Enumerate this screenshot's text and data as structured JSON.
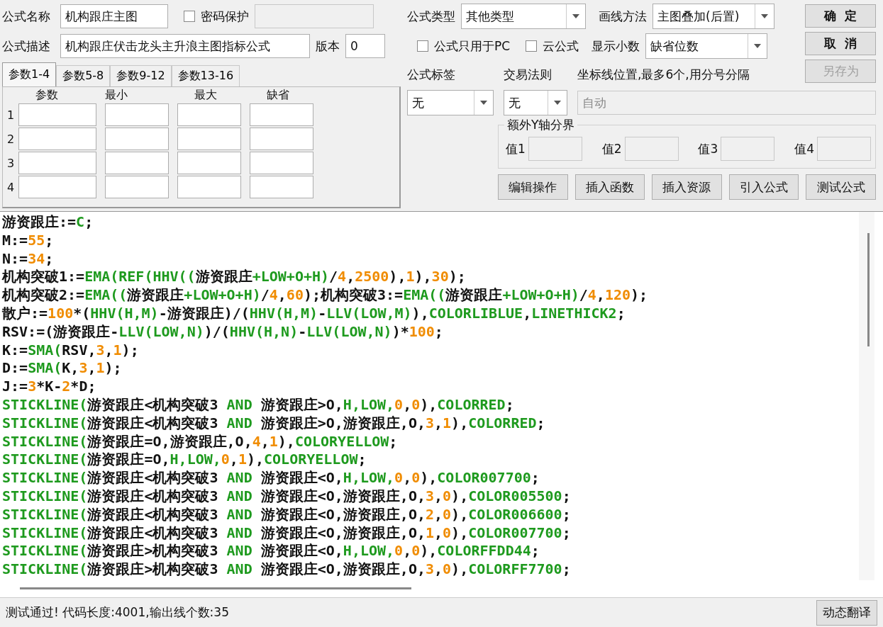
{
  "form": {
    "name": {
      "label": "公式名称",
      "value": "机构跟庄主图"
    },
    "password": {
      "label": "密码保护",
      "checked": false
    },
    "description": {
      "label": "公式描述",
      "value": "机构跟庄伏击龙头主升浪主图指标公式"
    },
    "version": {
      "label": "版本",
      "value": "0"
    },
    "type": {
      "label": "公式类型",
      "value": "其他类型"
    },
    "draw_method": {
      "label": "画线方法",
      "value": "主图叠加(后置)"
    },
    "pc_only": {
      "label": "公式只用于PC",
      "checked": false
    },
    "cloud": {
      "label": "云公式",
      "checked": false
    },
    "decimals": {
      "label": "显示小数",
      "value": "缺省位数"
    }
  },
  "buttons": [
    {
      "label": "确  定",
      "disabled": false
    },
    {
      "label": "取  消",
      "disabled": false
    },
    {
      "label": "另存为",
      "disabled": true
    }
  ],
  "param_tabs": [
    {
      "label": "参数1-4",
      "selected": true
    },
    {
      "label": "参数5-8",
      "selected": false
    },
    {
      "label": "参数9-12",
      "selected": false
    },
    {
      "label": "参数13-16",
      "selected": false
    }
  ],
  "param_table": {
    "columns": [
      "参数",
      "最小",
      "最大",
      "缺省"
    ],
    "rows": [
      "1",
      "2",
      "3",
      "4"
    ]
  },
  "tag": {
    "label": "公式标签",
    "value": "无"
  },
  "trade_rule": {
    "label": "交易法则",
    "value": "无"
  },
  "axis_lines": {
    "label": "坐标线位置,最多6个,用分号分隔",
    "value": "自动",
    "disabled": true
  },
  "y_axis_bounds": {
    "title": "额外Y轴分界",
    "fields": [
      "值1",
      "值2",
      "值3",
      "值4"
    ]
  },
  "actions": [
    "编辑操作",
    "插入函数",
    "插入资源",
    "引入公式",
    "测试公式"
  ],
  "code_lines": [
    [
      {
        "kind": "plain",
        "text": "游资跟庄:="
      },
      {
        "kind": "func",
        "text": "C"
      },
      {
        "kind": "plain",
        "text": ";"
      }
    ],
    [
      {
        "kind": "plain",
        "text": "M:="
      },
      {
        "kind": "num",
        "text": "55"
      },
      {
        "kind": "plain",
        "text": ";"
      }
    ],
    [
      {
        "kind": "plain",
        "text": "N:="
      },
      {
        "kind": "num",
        "text": "34"
      },
      {
        "kind": "plain",
        "text": ";"
      }
    ],
    [
      {
        "kind": "plain",
        "text": "机构突破1:="
      },
      {
        "kind": "func",
        "text": "EMA(REF(HHV(("
      },
      {
        "kind": "plain",
        "text": "游资跟庄"
      },
      {
        "kind": "func",
        "text": "+LOW+O+H)"
      },
      {
        "kind": "plain",
        "text": "/"
      },
      {
        "kind": "num",
        "text": "4"
      },
      {
        "kind": "plain",
        "text": ","
      },
      {
        "kind": "num",
        "text": "2500"
      },
      {
        "kind": "plain",
        "text": "),"
      },
      {
        "kind": "num",
        "text": "1"
      },
      {
        "kind": "plain",
        "text": "),"
      },
      {
        "kind": "num",
        "text": "30"
      },
      {
        "kind": "plain",
        "text": ");"
      }
    ],
    [
      {
        "kind": "plain",
        "text": "机构突破2:="
      },
      {
        "kind": "func",
        "text": "EMA(("
      },
      {
        "kind": "plain",
        "text": "游资跟庄"
      },
      {
        "kind": "func",
        "text": "+LOW+O+H)"
      },
      {
        "kind": "plain",
        "text": "/"
      },
      {
        "kind": "num",
        "text": "4"
      },
      {
        "kind": "plain",
        "text": ","
      },
      {
        "kind": "num",
        "text": "60"
      },
      {
        "kind": "plain",
        "text": ");机构突破3:="
      },
      {
        "kind": "func",
        "text": "EMA(("
      },
      {
        "kind": "plain",
        "text": "游资跟庄"
      },
      {
        "kind": "func",
        "text": "+LOW+O+H)"
      },
      {
        "kind": "plain",
        "text": "/"
      },
      {
        "kind": "num",
        "text": "4"
      },
      {
        "kind": "plain",
        "text": ","
      },
      {
        "kind": "num",
        "text": "120"
      },
      {
        "kind": "plain",
        "text": ");"
      }
    ],
    [
      {
        "kind": "plain",
        "text": "散户:="
      },
      {
        "kind": "num",
        "text": "100"
      },
      {
        "kind": "plain",
        "text": "*("
      },
      {
        "kind": "func",
        "text": "HHV(H,M)"
      },
      {
        "kind": "plain",
        "text": "-游资跟庄)/("
      },
      {
        "kind": "func",
        "text": "HHV(H,M)"
      },
      {
        "kind": "plain",
        "text": "-"
      },
      {
        "kind": "func",
        "text": "LLV(LOW,M)"
      },
      {
        "kind": "plain",
        "text": "),"
      },
      {
        "kind": "func",
        "text": "COLORLIBLUE"
      },
      {
        "kind": "plain",
        "text": ","
      },
      {
        "kind": "func",
        "text": "LINETHICK2"
      },
      {
        "kind": "plain",
        "text": ";"
      }
    ],
    [
      {
        "kind": "plain",
        "text": "RSV:=(游资跟庄-"
      },
      {
        "kind": "func",
        "text": "LLV(LOW,N)"
      },
      {
        "kind": "plain",
        "text": ")/("
      },
      {
        "kind": "func",
        "text": "HHV(H,N)"
      },
      {
        "kind": "plain",
        "text": "-"
      },
      {
        "kind": "func",
        "text": "LLV(LOW,N)"
      },
      {
        "kind": "plain",
        "text": ")*"
      },
      {
        "kind": "num",
        "text": "100"
      },
      {
        "kind": "plain",
        "text": ";"
      }
    ],
    [
      {
        "kind": "plain",
        "text": "K:="
      },
      {
        "kind": "func",
        "text": "SMA("
      },
      {
        "kind": "plain",
        "text": "RSV,"
      },
      {
        "kind": "num",
        "text": "3"
      },
      {
        "kind": "plain",
        "text": ","
      },
      {
        "kind": "num",
        "text": "1"
      },
      {
        "kind": "plain",
        "text": ");"
      }
    ],
    [
      {
        "kind": "plain",
        "text": "D:="
      },
      {
        "kind": "func",
        "text": "SMA("
      },
      {
        "kind": "plain",
        "text": "K,"
      },
      {
        "kind": "num",
        "text": "3"
      },
      {
        "kind": "plain",
        "text": ","
      },
      {
        "kind": "num",
        "text": "1"
      },
      {
        "kind": "plain",
        "text": ");"
      }
    ],
    [
      {
        "kind": "plain",
        "text": "J:="
      },
      {
        "kind": "num",
        "text": "3"
      },
      {
        "kind": "plain",
        "text": "*K-"
      },
      {
        "kind": "num",
        "text": "2"
      },
      {
        "kind": "plain",
        "text": "*D;"
      }
    ],
    [
      {
        "kind": "func",
        "text": "STICKLINE("
      },
      {
        "kind": "plain",
        "text": "游资跟庄<机构突破3 "
      },
      {
        "kind": "func",
        "text": "AND"
      },
      {
        "kind": "plain",
        "text": " 游资跟庄>O,"
      },
      {
        "kind": "func",
        "text": "H,LOW,"
      },
      {
        "kind": "num",
        "text": "0"
      },
      {
        "kind": "plain",
        "text": ","
      },
      {
        "kind": "num",
        "text": "0"
      },
      {
        "kind": "plain",
        "text": "),"
      },
      {
        "kind": "func",
        "text": "COLORRED"
      },
      {
        "kind": "plain",
        "text": ";"
      }
    ],
    [
      {
        "kind": "func",
        "text": "STICKLINE("
      },
      {
        "kind": "plain",
        "text": "游资跟庄<机构突破3 "
      },
      {
        "kind": "func",
        "text": "AND"
      },
      {
        "kind": "plain",
        "text": " 游资跟庄>O,游资跟庄,O,"
      },
      {
        "kind": "num",
        "text": "3"
      },
      {
        "kind": "plain",
        "text": ","
      },
      {
        "kind": "num",
        "text": "1"
      },
      {
        "kind": "plain",
        "text": "),"
      },
      {
        "kind": "func",
        "text": "COLORRED"
      },
      {
        "kind": "plain",
        "text": ";"
      }
    ],
    [
      {
        "kind": "func",
        "text": "STICKLINE("
      },
      {
        "kind": "plain",
        "text": "游资跟庄=O,游资跟庄,O,"
      },
      {
        "kind": "num",
        "text": "4"
      },
      {
        "kind": "plain",
        "text": ","
      },
      {
        "kind": "num",
        "text": "1"
      },
      {
        "kind": "plain",
        "text": "),"
      },
      {
        "kind": "func",
        "text": "COLORYELLOW"
      },
      {
        "kind": "plain",
        "text": ";"
      }
    ],
    [
      {
        "kind": "func",
        "text": "STICKLINE("
      },
      {
        "kind": "plain",
        "text": "游资跟庄=O,"
      },
      {
        "kind": "func",
        "text": "H,LOW,"
      },
      {
        "kind": "num",
        "text": "0"
      },
      {
        "kind": "plain",
        "text": ","
      },
      {
        "kind": "num",
        "text": "1"
      },
      {
        "kind": "plain",
        "text": "),"
      },
      {
        "kind": "func",
        "text": "COLORYELLOW"
      },
      {
        "kind": "plain",
        "text": ";"
      }
    ],
    [
      {
        "kind": "func",
        "text": "STICKLINE("
      },
      {
        "kind": "plain",
        "text": "游资跟庄<机构突破3 "
      },
      {
        "kind": "func",
        "text": "AND"
      },
      {
        "kind": "plain",
        "text": " 游资跟庄<O,"
      },
      {
        "kind": "func",
        "text": "H,LOW,"
      },
      {
        "kind": "num",
        "text": "0"
      },
      {
        "kind": "plain",
        "text": ","
      },
      {
        "kind": "num",
        "text": "0"
      },
      {
        "kind": "plain",
        "text": "),"
      },
      {
        "kind": "func",
        "text": "COLOR007700"
      },
      {
        "kind": "plain",
        "text": ";"
      }
    ],
    [
      {
        "kind": "func",
        "text": "STICKLINE("
      },
      {
        "kind": "plain",
        "text": "游资跟庄<机构突破3 "
      },
      {
        "kind": "func",
        "text": "AND"
      },
      {
        "kind": "plain",
        "text": " 游资跟庄<O,游资跟庄,O,"
      },
      {
        "kind": "num",
        "text": "3"
      },
      {
        "kind": "plain",
        "text": ","
      },
      {
        "kind": "num",
        "text": "0"
      },
      {
        "kind": "plain",
        "text": "),"
      },
      {
        "kind": "func",
        "text": "COLOR005500"
      },
      {
        "kind": "plain",
        "text": ";"
      }
    ],
    [
      {
        "kind": "func",
        "text": "STICKLINE("
      },
      {
        "kind": "plain",
        "text": "游资跟庄<机构突破3 "
      },
      {
        "kind": "func",
        "text": "AND"
      },
      {
        "kind": "plain",
        "text": " 游资跟庄<O,游资跟庄,O,"
      },
      {
        "kind": "num",
        "text": "2"
      },
      {
        "kind": "plain",
        "text": ","
      },
      {
        "kind": "num",
        "text": "0"
      },
      {
        "kind": "plain",
        "text": "),"
      },
      {
        "kind": "func",
        "text": "COLOR006600"
      },
      {
        "kind": "plain",
        "text": ";"
      }
    ],
    [
      {
        "kind": "func",
        "text": "STICKLINE("
      },
      {
        "kind": "plain",
        "text": "游资跟庄<机构突破3 "
      },
      {
        "kind": "func",
        "text": "AND"
      },
      {
        "kind": "plain",
        "text": " 游资跟庄<O,游资跟庄,O,"
      },
      {
        "kind": "num",
        "text": "1"
      },
      {
        "kind": "plain",
        "text": ","
      },
      {
        "kind": "num",
        "text": "0"
      },
      {
        "kind": "plain",
        "text": "),"
      },
      {
        "kind": "func",
        "text": "COLOR007700"
      },
      {
        "kind": "plain",
        "text": ";"
      }
    ],
    [
      {
        "kind": "func",
        "text": "STICKLINE("
      },
      {
        "kind": "plain",
        "text": "游资跟庄>机构突破3 "
      },
      {
        "kind": "func",
        "text": "AND"
      },
      {
        "kind": "plain",
        "text": " 游资跟庄<O,"
      },
      {
        "kind": "func",
        "text": "H,LOW,"
      },
      {
        "kind": "num",
        "text": "0"
      },
      {
        "kind": "plain",
        "text": ","
      },
      {
        "kind": "num",
        "text": "0"
      },
      {
        "kind": "plain",
        "text": "),"
      },
      {
        "kind": "func",
        "text": "COLORFFDD44"
      },
      {
        "kind": "plain",
        "text": ";"
      }
    ],
    [
      {
        "kind": "func",
        "text": "STICKLINE("
      },
      {
        "kind": "plain",
        "text": "游资跟庄>机构突破3 "
      },
      {
        "kind": "func",
        "text": "AND"
      },
      {
        "kind": "plain",
        "text": " 游资跟庄<O,游资跟庄,O,"
      },
      {
        "kind": "num",
        "text": "3"
      },
      {
        "kind": "plain",
        "text": ","
      },
      {
        "kind": "num",
        "text": "0"
      },
      {
        "kind": "plain",
        "text": "),"
      },
      {
        "kind": "func",
        "text": "COLORFF7700"
      },
      {
        "kind": "plain",
        "text": ";"
      }
    ]
  ],
  "status_bar": {
    "message": "测试通过! 代码长度:4001,输出线个数:35",
    "button": "动态翻译"
  }
}
